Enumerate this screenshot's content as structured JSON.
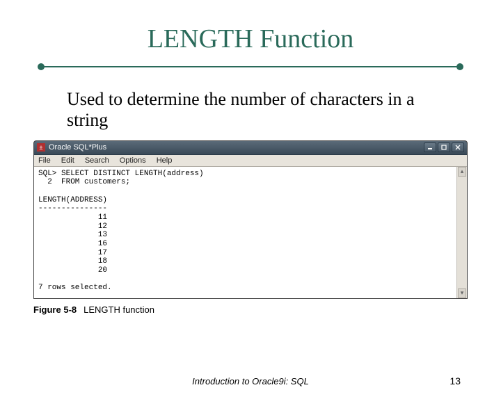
{
  "slide": {
    "title": "LENGTH Function",
    "body": "Used to determine the number of characters in a string",
    "footer_center": "Introduction to Oracle9i: SQL",
    "page_number": "13"
  },
  "figure": {
    "caption_label": "Figure 5-8",
    "caption_text": "LENGTH function"
  },
  "app": {
    "title": "Oracle SQL*Plus",
    "menu": {
      "file": "File",
      "edit": "Edit",
      "search": "Search",
      "options": "Options",
      "help": "Help"
    }
  },
  "terminal": {
    "line1": "SQL> SELECT DISTINCT LENGTH(address)",
    "line2": "  2  FROM customers;",
    "header": "LENGTH(ADDRESS)",
    "divider": "---------------",
    "rows": [
      "             11",
      "             12",
      "             13",
      "             16",
      "             17",
      "             18",
      "             20"
    ],
    "footer": "7 rows selected."
  },
  "chart_data": {
    "type": "table",
    "title": "LENGTH(ADDRESS)",
    "columns": [
      "LENGTH(ADDRESS)"
    ],
    "rows": [
      [
        11
      ],
      [
        12
      ],
      [
        13
      ],
      [
        16
      ],
      [
        17
      ],
      [
        18
      ],
      [
        20
      ]
    ],
    "row_count_label": "7 rows selected."
  }
}
